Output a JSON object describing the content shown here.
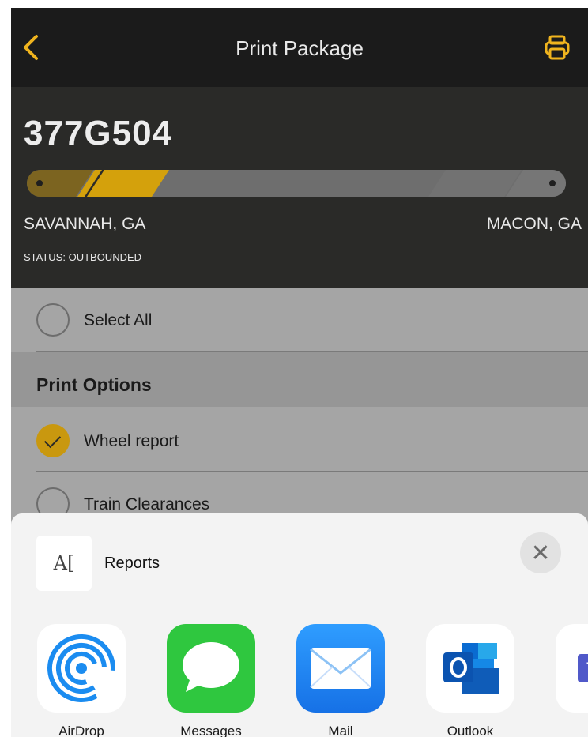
{
  "nav": {
    "title": "Print Package"
  },
  "header": {
    "train_id": "377G504",
    "origin": "SAVANNAH, GA",
    "destination": "MACON, GA",
    "status": "STATUS: OUTBOUNDED",
    "progress_fraction": 0.25
  },
  "list": {
    "select_all_label": "Select All",
    "section_title": "Print Options",
    "items": [
      {
        "label": "Wheel report",
        "checked": true
      },
      {
        "label": "Train Clearances",
        "checked": false
      }
    ]
  },
  "share_sheet": {
    "doc_thumb_text": "A[",
    "doc_title": "Reports",
    "close_symbol": "✕",
    "apps": [
      {
        "label": "AirDrop",
        "icon": "airdrop-icon"
      },
      {
        "label": "Messages",
        "icon": "messages-icon"
      },
      {
        "label": "Mail",
        "icon": "mail-icon"
      },
      {
        "label": "Outlook",
        "icon": "outlook-icon"
      },
      {
        "label": "T",
        "icon": "teams-icon"
      }
    ]
  },
  "colors": {
    "accent": "#c9980f",
    "nav_bg": "#1b1b1b",
    "header_bg": "#2a2a28"
  }
}
